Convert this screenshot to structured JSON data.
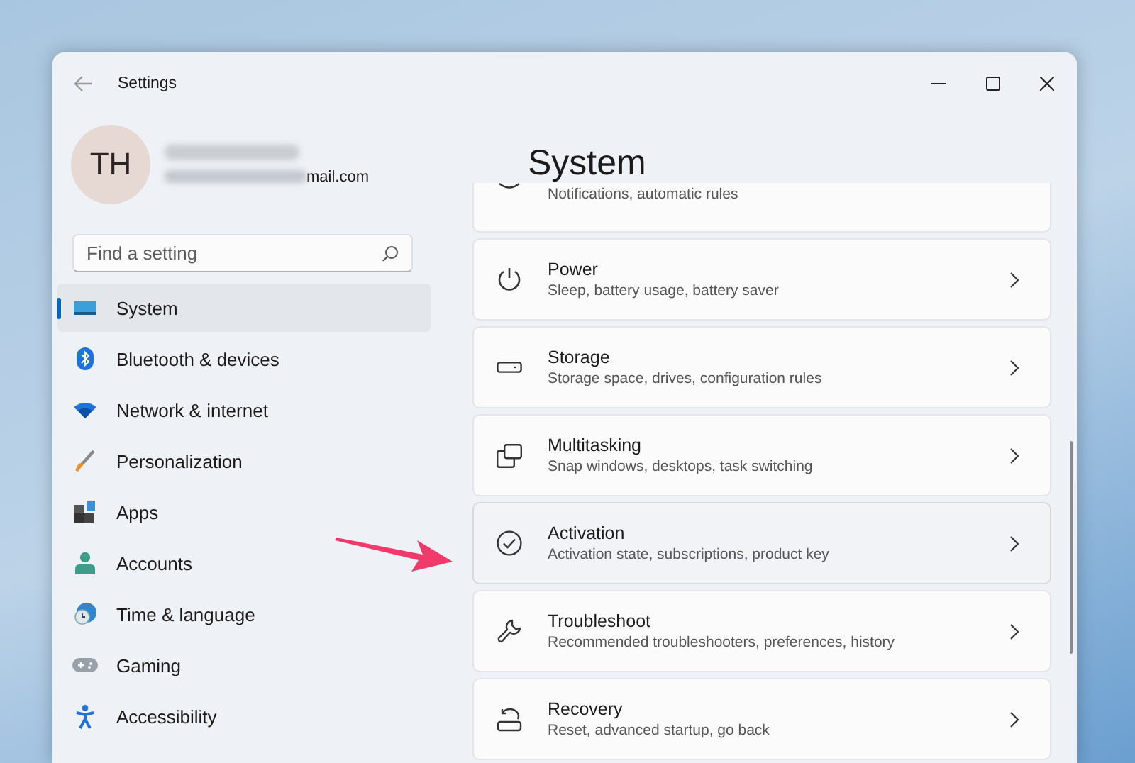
{
  "window": {
    "title": "Settings"
  },
  "profile": {
    "initials": "TH",
    "email": "mail.com"
  },
  "search": {
    "placeholder": "Find a setting"
  },
  "sidebar": {
    "items": [
      {
        "label": "System",
        "selected": true
      },
      {
        "label": "Bluetooth & devices",
        "selected": false
      },
      {
        "label": "Network & internet",
        "selected": false
      },
      {
        "label": "Personalization",
        "selected": false
      },
      {
        "label": "Apps",
        "selected": false
      },
      {
        "label": "Accounts",
        "selected": false
      },
      {
        "label": "Time & language",
        "selected": false
      },
      {
        "label": "Gaming",
        "selected": false
      },
      {
        "label": "Accessibility",
        "selected": false
      }
    ]
  },
  "content": {
    "heading": "System",
    "clipped_card": {
      "subtitle": "Notifications, automatic rules"
    },
    "cards": [
      {
        "title": "Power",
        "subtitle": "Sleep, battery usage, battery saver",
        "hovered": false
      },
      {
        "title": "Storage",
        "subtitle": "Storage space, drives, configuration rules",
        "hovered": false
      },
      {
        "title": "Multitasking",
        "subtitle": "Snap windows, desktops, task switching",
        "hovered": false
      },
      {
        "title": "Activation",
        "subtitle": "Activation state, subscriptions, product key",
        "hovered": true
      },
      {
        "title": "Troubleshoot",
        "subtitle": "Recommended troubleshooters, preferences, history",
        "hovered": false
      },
      {
        "title": "Recovery",
        "subtitle": "Reset, advanced startup, go back",
        "hovered": false
      }
    ]
  }
}
